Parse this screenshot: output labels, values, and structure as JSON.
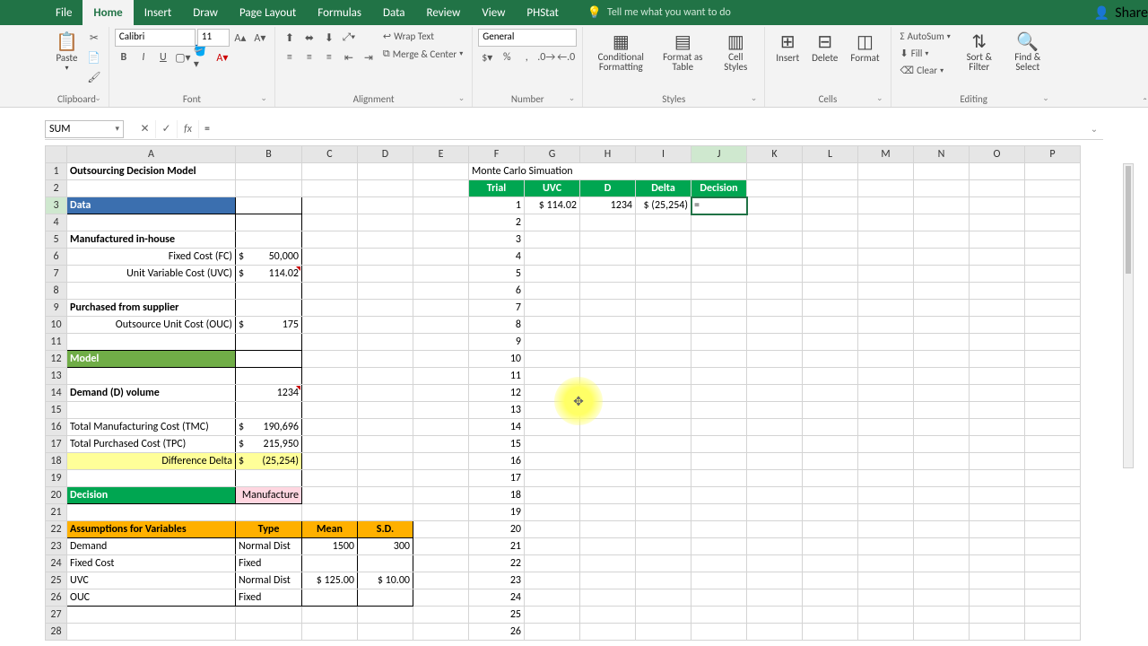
{
  "app": {
    "share": "Share"
  },
  "tabs": [
    "File",
    "Home",
    "Insert",
    "Draw",
    "Page Layout",
    "Formulas",
    "Data",
    "Review",
    "View",
    "PHStat"
  ],
  "tellme": "Tell me what you want to do",
  "ribbon": {
    "clipboard": {
      "paste": "Paste",
      "label": "Clipboard"
    },
    "font": {
      "name": "Calibri",
      "size": "11",
      "label": "Font"
    },
    "alignment": {
      "wrap": "Wrap Text",
      "merge": "Merge & Center",
      "label": "Alignment"
    },
    "number": {
      "format": "General",
      "label": "Number"
    },
    "styles": {
      "cond": "Conditional Formatting",
      "table": "Format as Table",
      "cell": "Cell Styles",
      "label": "Styles"
    },
    "cells": {
      "insert": "Insert",
      "delete": "Delete",
      "format": "Format",
      "label": "Cells"
    },
    "editing": {
      "autosum": "AutoSum",
      "fill": "Fill",
      "clear": "Clear",
      "sort": "Sort & Filter",
      "find": "Find & Select",
      "label": "Editing"
    }
  },
  "namebox": "SUM",
  "formula": "=",
  "columns": [
    "A",
    "B",
    "C",
    "D",
    "E",
    "F",
    "G",
    "H",
    "I",
    "J",
    "K",
    "L",
    "M",
    "N",
    "O",
    "P"
  ],
  "sheet": {
    "title": "Outsourcing Decision Model",
    "data_hdr": "Data",
    "mfg_hdr": "Manufactured in-house",
    "fc_label": "Fixed Cost (FC)",
    "fc_sym": "$",
    "fc_val": "50,000",
    "uvc_label": "Unit Variable Cost (UVC)",
    "uvc_sym": "$",
    "uvc_val": "114.02",
    "sup_hdr": "Purchased from supplier",
    "ouc_label": "Outsource Unit Cost (OUC)",
    "ouc_sym": "$",
    "ouc_val": "175",
    "model_hdr": "Model",
    "demand_label": "Demand (D) volume",
    "demand_val": "1234",
    "tmc_label": "Total Manufacturing Cost (TMC)",
    "tmc_sym": "$",
    "tmc_val": "190,696",
    "tpc_label": "Total Purchased Cost (TPC)",
    "tpc_sym": "$",
    "tpc_val": "215,950",
    "delta_label": "Difference Delta",
    "delta_sym": "$",
    "delta_val": "(25,254)",
    "dec_hdr": "Decision",
    "dec_val": "Manufacture",
    "assum_hdr": "Assumptions for Variables",
    "assum_cols": {
      "type": "Type",
      "mean": "Mean",
      "sd": "S.D."
    },
    "assum": {
      "demand": {
        "n": "Demand",
        "t": "Normal Dist",
        "m": "1500",
        "s": "300"
      },
      "fc": {
        "n": "Fixed Cost",
        "t": "Fixed",
        "m": "",
        "s": ""
      },
      "uvc": {
        "n": "UVC",
        "t": "Normal Dist",
        "m": "$ 125.00",
        "s": "$   10.00"
      },
      "ouc": {
        "n": "OUC",
        "t": "Fixed",
        "m": "",
        "s": ""
      }
    },
    "mc_title": "Monte Carlo Simuation",
    "mc_cols": {
      "trial": "Trial",
      "uvc": "UVC",
      "d": "D",
      "delta": "Delta",
      "dec": "Decision"
    },
    "mc_row1": {
      "trial": "1",
      "uvc": "$ 114.02",
      "d": "1234",
      "delta": "$ (25,254)",
      "dec": "="
    }
  }
}
